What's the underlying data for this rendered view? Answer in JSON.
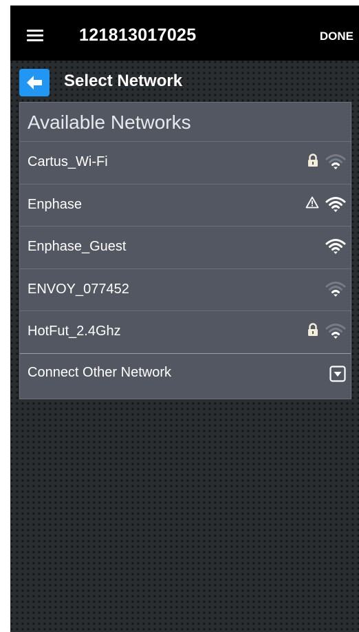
{
  "header": {
    "title": "121813017025",
    "done_label": "DONE",
    "menu_icon": "hamburger-menu-icon"
  },
  "subheader": {
    "title": "Select Network",
    "back_icon": "arrow-left-icon",
    "back_color": "#2196f3"
  },
  "networks": {
    "title": "Available Networks",
    "items": [
      {
        "name": "Cartus_Wi-Fi",
        "status_icon": "lock-icon",
        "signal_bars": 1
      },
      {
        "name": "Enphase",
        "status_icon": "warning-icon",
        "signal_bars": 3
      },
      {
        "name": "Enphase_Guest",
        "status_icon": "",
        "signal_bars": 3
      },
      {
        "name": "ENVOY_077452",
        "status_icon": "",
        "signal_bars": 1
      },
      {
        "name": "HotFut_2.4Ghz",
        "status_icon": "lock-icon",
        "signal_bars": 1
      }
    ],
    "connect_other_label": "Connect Other Network",
    "connect_other_icon": "dropdown-arrow-icon"
  },
  "colors": {
    "header_bg": "#000000",
    "panel_bg": "#535762",
    "accent": "#2196f3"
  }
}
